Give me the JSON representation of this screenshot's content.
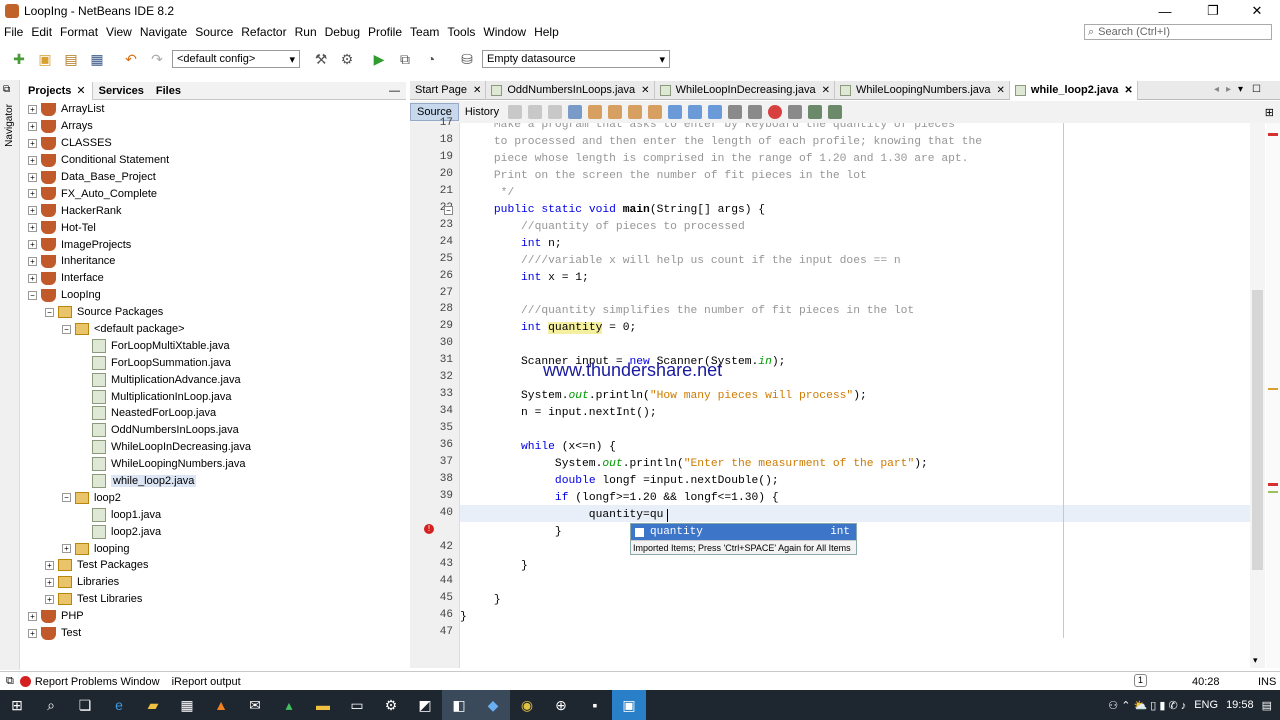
{
  "window": {
    "title": "LoopIng - NetBeans IDE 8.2",
    "minimize": "—",
    "maximize": "❐",
    "close": "✕"
  },
  "menu": [
    "File",
    "Edit",
    "Format",
    "View",
    "Navigate",
    "Source",
    "Refactor",
    "Run",
    "Debug",
    "Profile",
    "Team",
    "Tools",
    "Window",
    "Help"
  ],
  "search": {
    "placeholder": "Search (Ctrl+I)"
  },
  "toolbar": {
    "config": "<default config>",
    "datasource": "Empty datasource"
  },
  "navigator_label": "Navigator",
  "panel_tabs": [
    "Projects",
    "Services",
    "Files"
  ],
  "tree": [
    {
      "label": "ArrayList",
      "level": 0,
      "type": "proj",
      "exp": "+"
    },
    {
      "label": "Arrays",
      "level": 0,
      "type": "proj",
      "exp": "+"
    },
    {
      "label": "CLASSES",
      "level": 0,
      "type": "proj",
      "exp": "+"
    },
    {
      "label": "Conditional Statement",
      "level": 0,
      "type": "proj",
      "exp": "+"
    },
    {
      "label": "Data_Base_Project",
      "level": 0,
      "type": "proj",
      "exp": "+"
    },
    {
      "label": "FX_Auto_Complete",
      "level": 0,
      "type": "proj",
      "exp": "+"
    },
    {
      "label": "HackerRank",
      "level": 0,
      "type": "proj",
      "exp": "+"
    },
    {
      "label": "Hot-Tel",
      "level": 0,
      "type": "proj",
      "exp": "+"
    },
    {
      "label": "ImageProjects",
      "level": 0,
      "type": "proj",
      "exp": "+"
    },
    {
      "label": "Inheritance",
      "level": 0,
      "type": "proj",
      "exp": "+"
    },
    {
      "label": "Interface",
      "level": 0,
      "type": "proj",
      "exp": "+"
    },
    {
      "label": "LoopIng",
      "level": 0,
      "type": "proj",
      "exp": "−"
    },
    {
      "label": "Source Packages",
      "level": 1,
      "type": "pkg",
      "exp": "−"
    },
    {
      "label": "<default package>",
      "level": 2,
      "type": "pkg",
      "exp": "−"
    },
    {
      "label": "ForLoopMultiXtable.java",
      "level": 3,
      "type": "java",
      "exp": ""
    },
    {
      "label": "ForLoopSummation.java",
      "level": 3,
      "type": "java",
      "exp": ""
    },
    {
      "label": "MultiplicationAdvance.java",
      "level": 3,
      "type": "java",
      "exp": ""
    },
    {
      "label": "MultiplicationInLoop.java",
      "level": 3,
      "type": "java",
      "exp": ""
    },
    {
      "label": "NeastedForLoop.java",
      "level": 3,
      "type": "java",
      "exp": ""
    },
    {
      "label": "OddNumbersInLoops.java",
      "level": 3,
      "type": "java",
      "exp": ""
    },
    {
      "label": "WhileLoopInDecreasing.java",
      "level": 3,
      "type": "java",
      "exp": ""
    },
    {
      "label": "WhileLoopingNumbers.java",
      "level": 3,
      "type": "java",
      "exp": ""
    },
    {
      "label": "while_loop2.java",
      "level": 3,
      "type": "java",
      "exp": "",
      "selected": true
    },
    {
      "label": "loop2",
      "level": 2,
      "type": "pkg",
      "exp": "−"
    },
    {
      "label": "loop1.java",
      "level": 3,
      "type": "java",
      "exp": ""
    },
    {
      "label": "loop2.java",
      "level": 3,
      "type": "java",
      "exp": ""
    },
    {
      "label": "looping",
      "level": 2,
      "type": "pkg",
      "exp": "+"
    },
    {
      "label": "Test Packages",
      "level": 1,
      "type": "pkg",
      "exp": "+"
    },
    {
      "label": "Libraries",
      "level": 1,
      "type": "pkg",
      "exp": "+"
    },
    {
      "label": "Test Libraries",
      "level": 1,
      "type": "pkg",
      "exp": "+"
    },
    {
      "label": "PHP",
      "level": 0,
      "type": "proj",
      "exp": "+"
    },
    {
      "label": "Test",
      "level": 0,
      "type": "proj",
      "exp": "+"
    }
  ],
  "editor_tabs": [
    {
      "label": "Start Page",
      "active": false
    },
    {
      "label": "OddNumbersInLoops.java",
      "active": false
    },
    {
      "label": "WhileLoopInDecreasing.java",
      "active": false
    },
    {
      "label": "WhileLoopingNumbers.java",
      "active": false
    },
    {
      "label": "while_loop2.java",
      "active": true
    }
  ],
  "editor_toolbar": {
    "source": "Source",
    "history": "History"
  },
  "code_lines": [
    {
      "n": "17",
      "html": "<span class=\"cm\">     Make a program that asks to enter by keyboard the quantity of pieces</span>"
    },
    {
      "n": "18",
      "html": "<span class=\"cm\">     to processed and then enter the length of each profile; knowing that the</span>"
    },
    {
      "n": "19",
      "html": "<span class=\"cm\">     piece whose length is comprised in the range of 1.20 and 1.30 are apt.</span>"
    },
    {
      "n": "20",
      "html": "<span class=\"cm\">     Print on the screen the number of fit pieces in the lot</span>"
    },
    {
      "n": "21",
      "html": "<span class=\"cm\">      */</span>"
    },
    {
      "n": "22",
      "html": "     <span class=\"kw\">public static void</span> <b>main</b>(String[] args) {"
    },
    {
      "n": "23",
      "html": "<span class=\"cm\">         //quantity of pieces to processed</span>"
    },
    {
      "n": "24",
      "html": "         <span class=\"kw\">int</span> n;"
    },
    {
      "n": "25",
      "html": "<span class=\"cm\">         ////variable x will help us count if the input does == n</span>"
    },
    {
      "n": "26",
      "html": "         <span class=\"kw\">int</span> x = 1;"
    },
    {
      "n": "27",
      "html": ""
    },
    {
      "n": "28",
      "html": "<span class=\"cm\">         ///quantity simplifies the number of fit pieces in the lot</span>"
    },
    {
      "n": "29",
      "html": "         <span class=\"kw\">int</span> <span class=\"hl\">quantity</span> = 0;"
    },
    {
      "n": "30",
      "html": ""
    },
    {
      "n": "31",
      "html": "         Scanner input = <span class=\"kw\">new</span> Scanner(System.<span class=\"fld\">in</span>);"
    },
    {
      "n": "32",
      "html": ""
    },
    {
      "n": "33",
      "html": "         System.<span class=\"fld\">out</span>.println(<span class=\"st2\">\"How many pieces will process\"</span>);"
    },
    {
      "n": "34",
      "html": "         n = input.nextInt();"
    },
    {
      "n": "35",
      "html": ""
    },
    {
      "n": "36",
      "html": "         <span class=\"kw\">while</span> (x&lt;=n) {"
    },
    {
      "n": "37",
      "html": "              System.<span class=\"fld\">out</span>.println(<span class=\"st2\">\"Enter the measurment of the part\"</span>);"
    },
    {
      "n": "38",
      "html": "              <span class=\"kw\">double</span> longf =input.nextDouble();"
    },
    {
      "n": "39",
      "html": "              <span class=\"kw\">if</span> (longf&gt;=1.20 &amp;&amp; longf&lt;=1.30) {"
    },
    {
      "n": "40",
      "html": "                   quantity=qu"
    },
    {
      "n": "",
      "html": "              }"
    },
    {
      "n": "42",
      "html": ""
    },
    {
      "n": "43",
      "html": "         }"
    },
    {
      "n": "44",
      "html": ""
    },
    {
      "n": "45",
      "html": "     }"
    },
    {
      "n": "46",
      "html": "}"
    },
    {
      "n": "47",
      "html": ""
    }
  ],
  "watermark": "www.thundershare.net",
  "autocomplete": {
    "item": "quantity",
    "type": "int",
    "hint": "Imported Items; Press 'Ctrl+SPACE' Again for All Items"
  },
  "status": {
    "report": "Report Problems Window",
    "ireport": "iReport output",
    "position": "40:28",
    "mode": "INS"
  },
  "taskbar": {
    "lang": "ENG",
    "time": "19:58"
  }
}
